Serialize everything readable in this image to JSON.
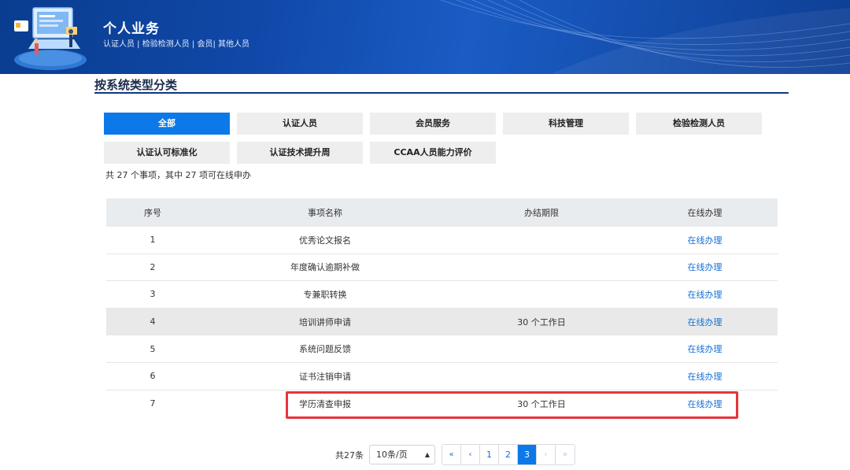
{
  "header": {
    "title": "个人业务",
    "subtitle": "认证人员 | 检验检测人员 | 会员| 其他人员"
  },
  "section": {
    "title": "按系统类型分类"
  },
  "categories": [
    {
      "label": "全部",
      "active": true
    },
    {
      "label": "认证人员"
    },
    {
      "label": "会员服务"
    },
    {
      "label": "科技管理"
    },
    {
      "label": "检验检测人员"
    },
    {
      "label": "认证认可标准化"
    },
    {
      "label": "认证技术提升周"
    },
    {
      "label": "CCAA人员能力评价"
    }
  ],
  "summary": "共 27 个事项，其中 27 项可在线申办",
  "table": {
    "headers": [
      "序号",
      "事项名称",
      "办结期限",
      "在线办理"
    ],
    "rows": [
      {
        "no": "1",
        "name": "优秀论文报名",
        "deadline": "",
        "action": "在线办理"
      },
      {
        "no": "2",
        "name": "年度确认逾期补做",
        "deadline": "",
        "action": "在线办理"
      },
      {
        "no": "3",
        "name": "专兼职转换",
        "deadline": "",
        "action": "在线办理"
      },
      {
        "no": "4",
        "name": "培训讲师申请",
        "deadline": "30 个工作日",
        "action": "在线办理"
      },
      {
        "no": "5",
        "name": "系统问题反馈",
        "deadline": "",
        "action": "在线办理"
      },
      {
        "no": "6",
        "name": "证书注销申请",
        "deadline": "",
        "action": "在线办理"
      },
      {
        "no": "7",
        "name": "学历清查申报",
        "deadline": "30 个工作日",
        "action": "在线办理"
      }
    ]
  },
  "pagination": {
    "total": "共27条",
    "page_size": "10条/页",
    "first": "«",
    "prev": "‹",
    "pages": [
      "1",
      "2",
      "3"
    ],
    "current": "3",
    "next": "›",
    "last": "»"
  },
  "colors": {
    "accent": "#0d79e8",
    "highlight_border": "#e8333a",
    "banner": "#1048a8"
  }
}
